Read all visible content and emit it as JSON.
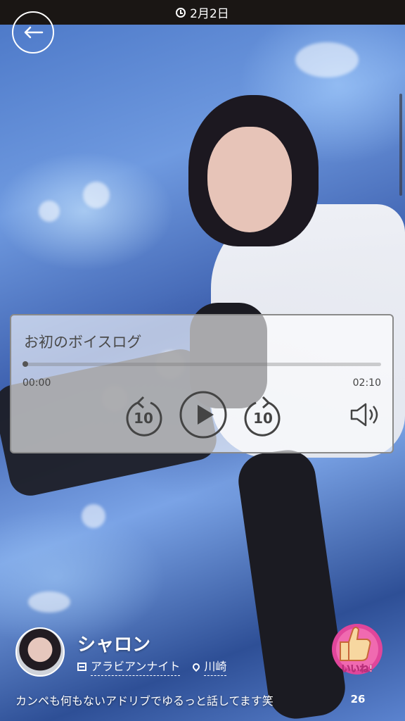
{
  "status_bar": {
    "date": "2月2日"
  },
  "player": {
    "title": "お初のボイスログ",
    "current_time": "00:00",
    "total_time": "02:10",
    "progress": 0,
    "skip_back_seconds": "10",
    "skip_forward_seconds": "10"
  },
  "profile": {
    "name": "シャロン",
    "shop": "アラビアンナイト",
    "area": "川崎",
    "caption": "カンペも何もないアドリブでゆるっと話してます笑"
  },
  "like": {
    "label": "いいね!",
    "count": "26",
    "color": "#e0469b"
  },
  "icons": [
    "clock-icon",
    "back-arrow-icon",
    "rewind-10-icon",
    "play-icon",
    "forward-10-icon",
    "volume-icon",
    "store-icon",
    "location-pin-icon",
    "thumbs-up-icon"
  ]
}
